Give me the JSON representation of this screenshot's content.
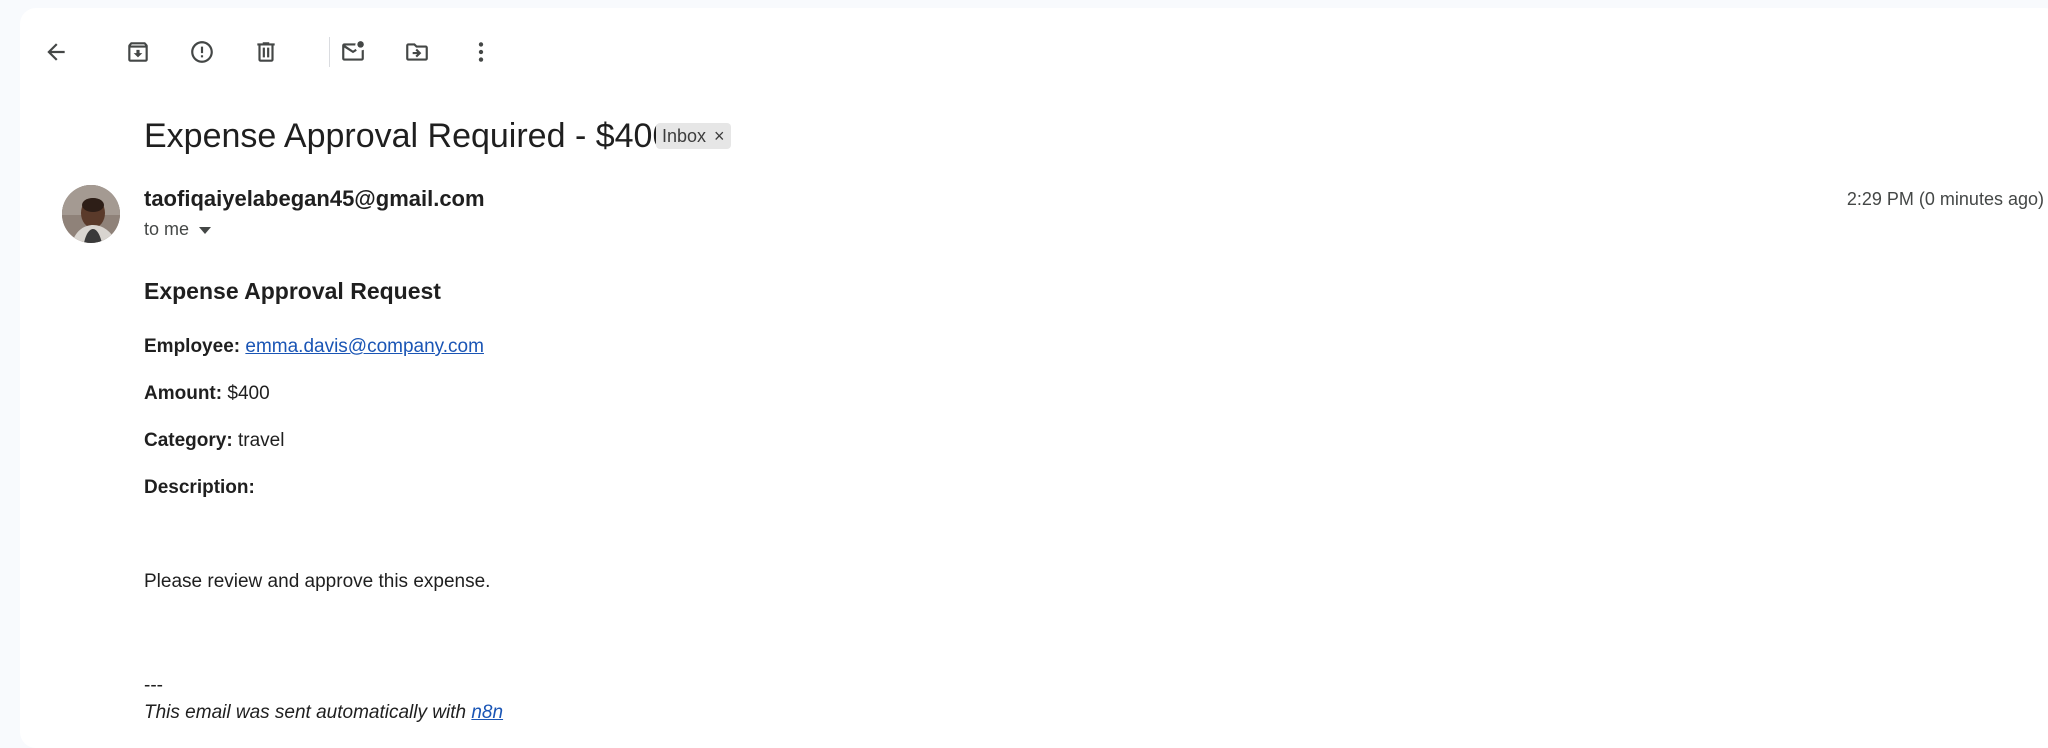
{
  "toolbar": {
    "back": "arrow-left-icon",
    "archive": "archive-icon",
    "spam": "report-spam-icon",
    "delete": "trash-icon",
    "mark_unread": "mark-unread-icon",
    "move": "move-to-icon",
    "more": "more-vert-icon"
  },
  "email": {
    "subject": "Expense Approval Required - $400",
    "label": "Inbox",
    "label_remove": "×",
    "sender": "taofiqaiyelabegan45@gmail.com",
    "recipient": "to me",
    "time": "2:29 PM (0 minutes ago)"
  },
  "body": {
    "heading": "Expense Approval Request",
    "employee_label": "Employee:",
    "employee_value": "emma.davis@company.com",
    "amount_label": "Amount:",
    "amount_value": "$400",
    "category_label": "Category:",
    "category_value": "travel",
    "description_label": "Description:",
    "request_text": "Please review and approve this expense.",
    "separator": "---",
    "signature_text": "This email was sent automatically with",
    "signature_link": "n8n"
  },
  "colors": {
    "link": "#1a55b5",
    "background": "#f8fafd",
    "panel": "#ffffff"
  }
}
